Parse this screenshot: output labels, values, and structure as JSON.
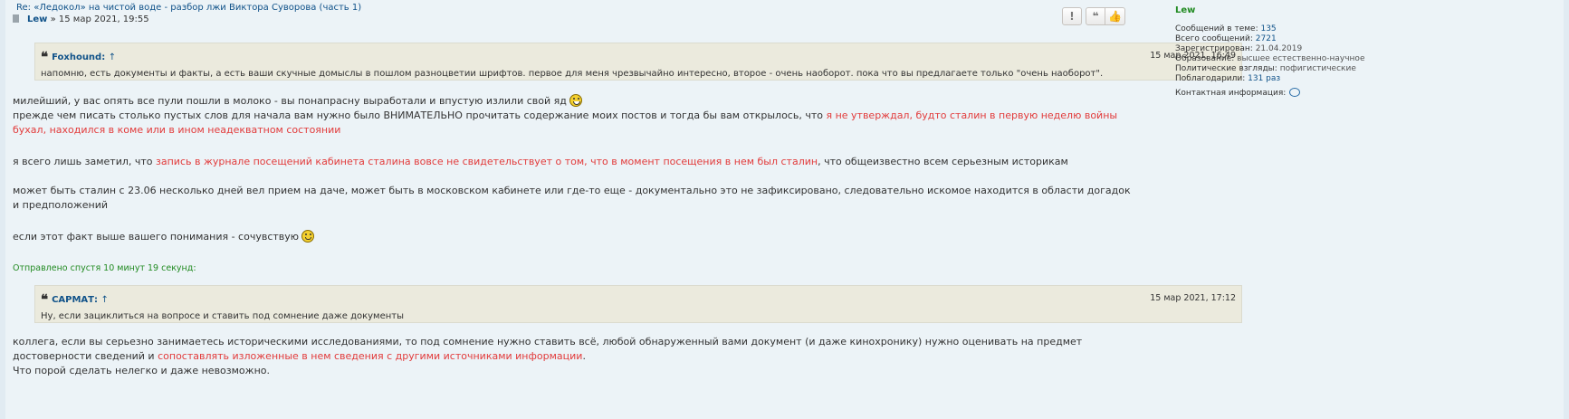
{
  "post": {
    "title": "Re: «Ледокол» на чистой воде - разбор лжи Виктора Суворова (часть 1)",
    "author": "Lew",
    "date_sep": " » ",
    "date": "15 мар 2021, 19:55",
    "buttons": [
      {
        "label": "!",
        "icon": "report-icon"
      },
      {
        "label": "❝",
        "icon": "quote-icon"
      },
      {
        "label": "👍",
        "icon": "thumbs-up-icon"
      }
    ]
  },
  "quote1": {
    "author": "Foxhound",
    "arrow": "↑",
    "colon": ": ",
    "date": "15 мар 2021, 16:49",
    "text": "напомню, есть документы и факты, а есть ваши скучные домыслы в пошлом разноцветии шрифтов. первое для меня чрезвычайно интересно, второе - очень наоборот. пока что вы предлагаете только \"очень наоборот\"."
  },
  "body1": {
    "line1": "милейший, у вас опять все пули пошли в молоко - вы понапрасну выработали и впустую излили свой яд",
    "line2_plain": "прежде чем писать столько пустых слов для начала вам нужно было ВНИМАТЕЛЬНО прочитать содержание моих постов и тогда бы вам открылось, что ",
    "line2_red": "я не утверждал, будто сталин в первую неделю войны бухал, находился в коме или в ином неадекватном состоянии"
  },
  "body2": {
    "p1_plain": "я всего лишь заметил, что ",
    "p1_red": "запись в журнале посещений кабинета сталина вовсе не свидетельствует о том, что в момент посещения в нем был сталин",
    "p1_tail": ", что общеизвестно всем серьезным историкам",
    "p2": "может быть сталин с 23.06 несколько дней вел прием на даче, может быть в московском кабинете или где-то еще - документально это не зафиксировано, следовательно искомое находится в области догадок и предположений",
    "p3": "если этот факт выше вашего понимания - сочувствую"
  },
  "sent_later": "Отправлено спустя 10 минут 19 секунд:",
  "quote2": {
    "author": "САРМАТ",
    "arrow": "↑",
    "colon": ": ",
    "date": "15 мар 2021, 17:12",
    "text": "Ну, если зациклиться на вопросе и ставить под сомнение даже документы"
  },
  "body3": {
    "p1_plain": "коллега, если вы серьезно занимаетесь историческими исследованиями, то под сомнение нужно ставить всё, любой обнаруженный вами документ (и даже кинохронику) нужно оценивать на предмет достоверности сведений и ",
    "p1_red": "сопоставлять изложенные в нем сведения с другими источниками информации",
    "p1_end": ".",
    "p2": "Что порой сделать нелегко и даже невозможно."
  },
  "profile": {
    "username": "Lew",
    "rows": [
      {
        "label": "Сообщений в теме:",
        "value": "135"
      },
      {
        "label": "Всего сообщений:",
        "value": "2721"
      },
      {
        "label": "Зарегистрирован:",
        "value": "21.04.2019"
      },
      {
        "label": "Образование:",
        "value": "высшее естественно-научное"
      },
      {
        "label": "Политические взгляды:",
        "value": "пофигистические"
      },
      {
        "label": "Поблагодарили:",
        "value": "131 раз"
      }
    ],
    "contact_label": "Контактная информация:"
  },
  "colors": {
    "link": "#105289",
    "highlight": "#e23b3b",
    "green": "#228b22",
    "quote_bg": "#ebeadd",
    "post_bg": "#ecf3f7"
  }
}
